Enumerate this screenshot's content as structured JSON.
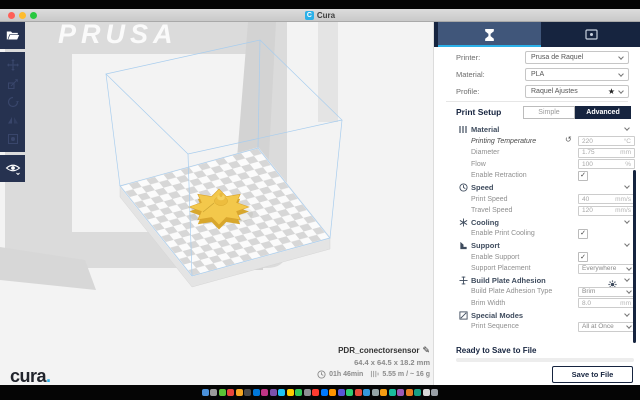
{
  "window": {
    "title": "Cura"
  },
  "titlebar": {
    "traffic_lights": [
      "#ff5f57",
      "#febc2e",
      "#28c840"
    ]
  },
  "sidebar": {
    "tool_icons": [
      "open-file-icon",
      "move-tool-icon",
      "scale-tool-icon",
      "rotate-tool-icon",
      "mirror-tool-icon",
      "per-model-settings-icon",
      "view-mode-eye-icon"
    ]
  },
  "viewport": {
    "printer_frame_text": "PRUSA",
    "bed_colors": {
      "light": "#fbfbfb",
      "dark": "#d7d7d7"
    },
    "model_color": "#f3c84b",
    "build_volume_line_color": "#a8cdee"
  },
  "tabs": {
    "prepare_icon": "prepare-hourglass-icon",
    "monitor_icon": "monitor-icon",
    "active_underline_color": "#2bb0e8"
  },
  "machine": {
    "printer": {
      "label": "Printer:",
      "value": "Prusa de Raquel"
    },
    "material": {
      "label": "Material:",
      "value": "PLA"
    },
    "profile": {
      "label": "Profile:",
      "value": "Raquel Ajustes",
      "star_icon": "★"
    }
  },
  "print_setup": {
    "label": "Print Setup",
    "simple": "Simple",
    "advanced": "Advanced",
    "active": "Advanced"
  },
  "settings": {
    "sections": [
      {
        "icon": "material-spool-icon",
        "title": "Material",
        "rows": [
          {
            "label": "Printing Temperature",
            "italic": true,
            "reset": true,
            "type": "input",
            "value": "220",
            "unit": "°C"
          },
          {
            "label": "Diameter",
            "type": "input",
            "value": "1.75",
            "unit": "mm"
          },
          {
            "label": "Flow",
            "type": "input",
            "value": "100",
            "unit": "%"
          },
          {
            "label": "Enable Retraction",
            "type": "checkbox",
            "checked": true
          }
        ]
      },
      {
        "icon": "speed-clock-icon",
        "title": "Speed",
        "rows": [
          {
            "label": "Print Speed",
            "type": "input",
            "value": "40",
            "unit": "mm/s"
          },
          {
            "label": "Travel Speed",
            "type": "input",
            "value": "120",
            "unit": "mm/s"
          }
        ]
      },
      {
        "icon": "cooling-fan-icon",
        "title": "Cooling",
        "rows": [
          {
            "label": "Enable Print Cooling",
            "type": "checkbox",
            "checked": true
          }
        ]
      },
      {
        "icon": "support-icon",
        "title": "Support",
        "rows": [
          {
            "label": "Enable Support",
            "type": "checkbox",
            "checked": true
          },
          {
            "label": "Support Placement",
            "type": "select",
            "value": "Everywhere"
          }
        ]
      },
      {
        "icon": "adhesion-icon",
        "title": "Build Plate Adhesion",
        "gear": true,
        "rows": [
          {
            "label": "Build Plate Adhesion Type",
            "type": "select",
            "value": "Brim"
          },
          {
            "label": "Brim Width",
            "type": "input",
            "value": "8.0",
            "unit": "mm"
          }
        ]
      },
      {
        "icon": "special-modes-icon",
        "title": "Special Modes",
        "rows": [
          {
            "label": "Print Sequence",
            "type": "select",
            "value": "All at Once"
          }
        ]
      }
    ]
  },
  "footer": {
    "status": "Ready to Save to File",
    "save_label": "Save to File"
  },
  "model": {
    "name": "PDR_conectorsensor",
    "dimensions": "64.4 x 64.5 x 18.2 mm",
    "print_time": "01h 46min",
    "material_usage": "5.55 m / ~ 16 g"
  },
  "logo": {
    "text": "cura",
    "dot": "."
  },
  "dock": {
    "icon_colors": [
      "#4a90d9",
      "#9b9b9b",
      "#5bc236",
      "#e8453c",
      "#f5a623",
      "#4a4a4a",
      "#0077d9",
      "#c13584",
      "#7b52ab",
      "#1ec4f4",
      "#ffcc00",
      "#34c759",
      "#8e8e93",
      "#ff3b30",
      "#007aff",
      "#ff9500",
      "#5856d6",
      "#2ecc71",
      "#e74c3c",
      "#3498db",
      "#95a5a6",
      "#f39c12",
      "#1abc9c",
      "#9b59b6",
      "#e67e22",
      "#16a085",
      "#d8d8d8",
      "#9aa0a6"
    ]
  }
}
